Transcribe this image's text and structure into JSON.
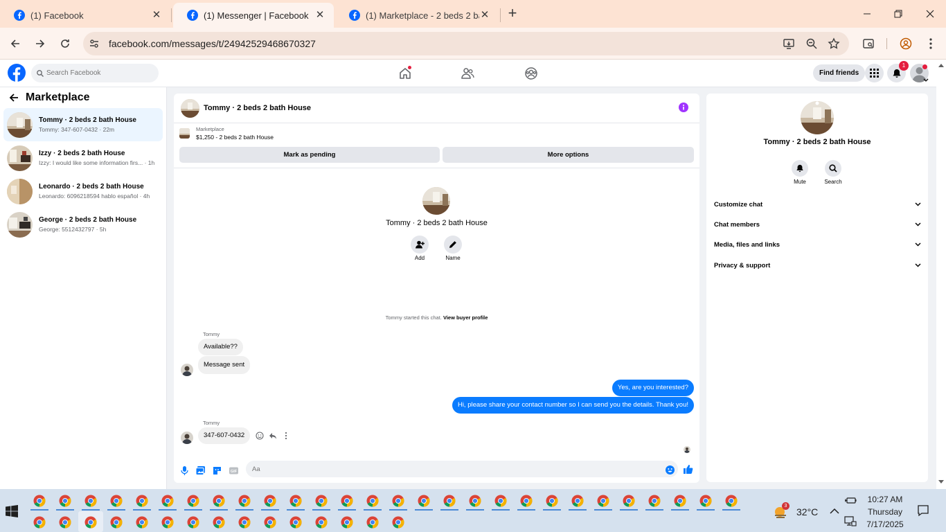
{
  "browser": {
    "tabs": [
      {
        "title": "(1) Facebook",
        "active": false
      },
      {
        "title": "(1) Messenger | Facebook",
        "active": true
      },
      {
        "title": "(1) Marketplace - 2 beds 2 bath",
        "active": false
      }
    ],
    "url": "facebook.com/messages/t/24942529468670327"
  },
  "fb_nav": {
    "search_placeholder": "Search Facebook",
    "find_friends": "Find friends",
    "notification_count": "1"
  },
  "sidebar": {
    "title": "Marketplace",
    "conversations": [
      {
        "name": "Tommy · 2 beds 2 bath House",
        "preview": "Tommy: 347-607-0432 · 22m",
        "selected": true
      },
      {
        "name": "Izzy · 2 beds 2 bath House",
        "preview": "Izzy: I would like some information firs... · 1h",
        "selected": false
      },
      {
        "name": "Leonardo · 2 beds 2 bath House",
        "preview": "Leonardo: 6096218594 hablo español · 4h",
        "selected": false
      },
      {
        "name": "George · 2 beds 2 bath House",
        "preview": "George: 5512432797 · 5h",
        "selected": false
      }
    ]
  },
  "chat": {
    "title": "Tommy · 2 beds 2 bath House",
    "listing": {
      "category": "Marketplace",
      "title": "$1,250 - 2 beds 2 bath House"
    },
    "buttons": {
      "mark_pending": "Mark as pending",
      "more_options": "More options"
    },
    "profile": {
      "name": "Tommy · 2 beds 2 bath House",
      "add": "Add",
      "name_label": "Name"
    },
    "started": {
      "text": "Tommy started this chat.",
      "link": "View buyer profile"
    },
    "messages": [
      {
        "sender": "Tommy",
        "text": "Available??",
        "dir": "in"
      },
      {
        "sender": "",
        "text": "Message sent",
        "dir": "in"
      },
      {
        "sender": "",
        "text": "Yes, are you interested?",
        "dir": "out"
      },
      {
        "sender": "",
        "text": "Hi, please share your contact number so I can send you the details. Thank you!",
        "dir": "out"
      },
      {
        "sender": "Tommy",
        "text": "347-607-0432",
        "dir": "in"
      }
    ],
    "input_placeholder": "Aa"
  },
  "right_panel": {
    "name": "Tommy · 2 beds 2 bath House",
    "mute": "Mute",
    "search": "Search",
    "sections": [
      "Customize chat",
      "Chat members",
      "Media, files and links",
      "Privacy & support"
    ]
  },
  "taskbar": {
    "weather_badge": "3",
    "temperature": "32°C",
    "time": "10:27 AM",
    "day": "Thursday",
    "date": "7/17/2025"
  },
  "colors": {
    "fb_blue": "#0866ff",
    "messenger_blue": "#0a7cff",
    "info_purple": "#a033ff",
    "selected_bg": "#ebf5ff"
  }
}
